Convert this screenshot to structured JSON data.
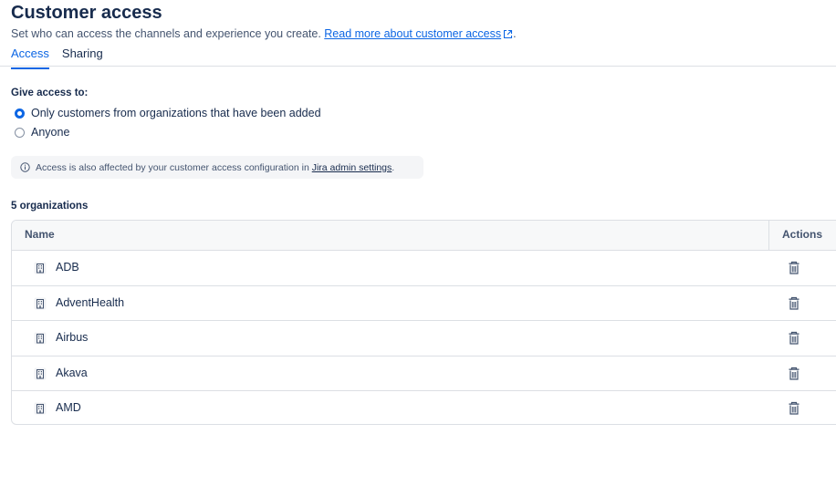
{
  "header": {
    "title": "Customer access",
    "subtitle": "Set who can access the channels and experience you create.",
    "read_more_link": "Read more about customer access"
  },
  "tabs": [
    {
      "label": "Access",
      "active": true
    },
    {
      "label": "Sharing",
      "active": false
    }
  ],
  "access": {
    "heading": "Give access to:",
    "options": [
      {
        "label": "Only customers from organizations that have been added",
        "selected": true
      },
      {
        "label": "Anyone",
        "selected": false
      }
    ]
  },
  "info": {
    "text": "Access is also affected by your customer access configuration in",
    "link": "Jira admin settings",
    "suffix": "."
  },
  "organizations": {
    "count_label": "5 organizations",
    "columns": [
      "Name",
      "Actions"
    ],
    "rows": [
      {
        "name": "ADB"
      },
      {
        "name": "AdventHealth"
      },
      {
        "name": "Airbus"
      },
      {
        "name": "Akava"
      },
      {
        "name": "AMD"
      }
    ]
  },
  "colors": {
    "accent": "#0c66e4",
    "text": "#172b4d",
    "subtle_text": "#44546f",
    "border": "#dcdfe4"
  }
}
